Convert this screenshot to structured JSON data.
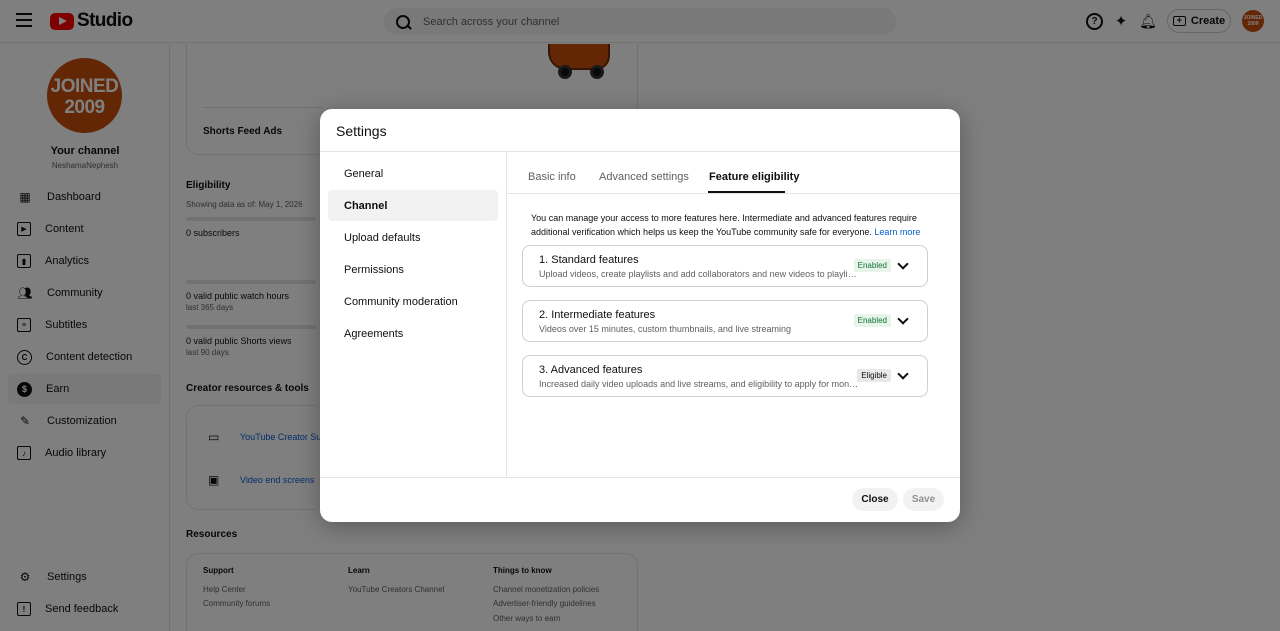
{
  "topbar": {
    "logo_text": "Studio",
    "search_placeholder": "Search across your channel",
    "create_label": "Create",
    "help_glyph": "?",
    "avatar_text": "JOINED 2009"
  },
  "sidebar": {
    "avatar_line1": "JOINED",
    "avatar_line2": "2009",
    "channel_title": "Your channel",
    "channel_handle": "NeshamaNephesh",
    "items": [
      {
        "label": "Dashboard",
        "icon": "dashboard-icon"
      },
      {
        "label": "Content",
        "icon": "content-icon"
      },
      {
        "label": "Analytics",
        "icon": "analytics-icon"
      },
      {
        "label": "Community",
        "icon": "community-icon"
      },
      {
        "label": "Subtitles",
        "icon": "subtitles-icon"
      },
      {
        "label": "Content detection",
        "icon": "content-detection-icon"
      },
      {
        "label": "Earn",
        "icon": "earn-icon"
      },
      {
        "label": "Customization",
        "icon": "customization-icon"
      },
      {
        "label": "Audio library",
        "icon": "audio-library-icon"
      }
    ],
    "bottom_items": [
      {
        "label": "Settings",
        "icon": "settings-icon"
      },
      {
        "label": "Send feedback",
        "icon": "feedback-icon"
      }
    ]
  },
  "background": {
    "shorts_feed_ads": "Shorts Feed Ads",
    "eligibility_heading": "Eligibility",
    "showing_data": "Showing data as of: May 1, 2026",
    "subscribers": "0 subscribers",
    "watch_hours": "0 valid public watch hours",
    "watch_hours_period": "last 365 days",
    "shorts_views": "0 valid public Shorts views",
    "shorts_views_period": "last 90 days",
    "creator_resources_heading": "Creator resources & tools",
    "tool_1": "YouTube Creator Sup",
    "tool_2": "Video end screens",
    "resources_heading": "Resources",
    "support_heading": "Support",
    "support_links": [
      "Help Center",
      "Community forums"
    ],
    "learn_heading": "Learn",
    "learn_links": [
      "YouTube Creators Channel"
    ],
    "things_heading": "Things to know",
    "things_links": [
      "Channel monetization policies",
      "Advertiser-friendly guidelines",
      "Other ways to earn"
    ]
  },
  "dialog": {
    "title": "Settings",
    "left_nav": [
      "General",
      "Channel",
      "Upload defaults",
      "Permissions",
      "Community moderation",
      "Agreements"
    ],
    "active_left": "Channel",
    "tabs": [
      "Basic info",
      "Advanced settings",
      "Feature eligibility"
    ],
    "active_tab": "Feature eligibility",
    "intro_text": "You can manage your access to more features here. Intermediate and advanced features require additional verification which helps us keep the YouTube community safe for everyone.",
    "learn_more": "Learn more",
    "features": [
      {
        "title": "1. Standard features",
        "desc": "Upload videos, create playlists and add collaborators and new videos to playlists",
        "status": "Enabled"
      },
      {
        "title": "2. Intermediate features",
        "desc": "Videos over 15 minutes, custom thumbnails, and live streaming",
        "status": "Enabled"
      },
      {
        "title": "3. Advanced features",
        "desc": "Increased daily video uploads and live streams, and eligibility to apply for monetization",
        "status": "Eligible"
      }
    ],
    "close_label": "Close",
    "save_label": "Save"
  },
  "colors": {
    "brand_red": "#ff0000",
    "avatar_orange": "#c64f0c",
    "link_blue": "#065fd4",
    "enabled_green": "#137333"
  }
}
